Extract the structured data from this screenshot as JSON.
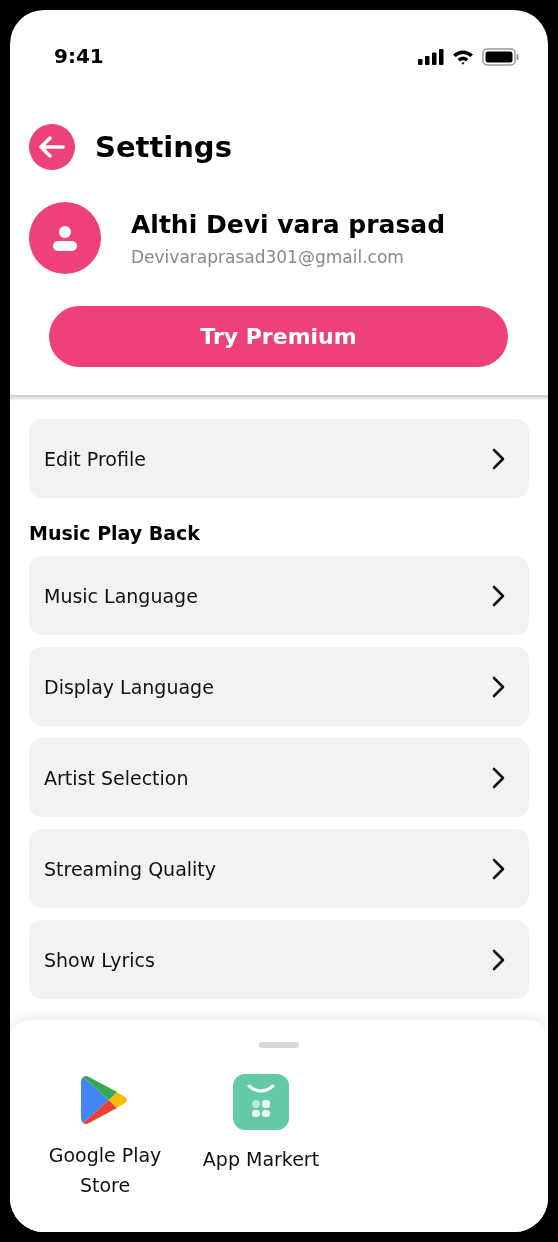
{
  "status_bar": {
    "time": "9:41"
  },
  "header": {
    "title": "Settings"
  },
  "profile": {
    "name": "Althi Devi vara prasad",
    "email": "Devivaraprasad301@gmail.com"
  },
  "premium_button": {
    "label": "Try Premium"
  },
  "menu": [
    {
      "kind": "item",
      "label": "Edit Profile"
    },
    {
      "kind": "heading",
      "label": "Music Play Back"
    },
    {
      "kind": "item",
      "label": "Music Language"
    },
    {
      "kind": "item",
      "label": "Display Language"
    },
    {
      "kind": "item",
      "label": "Artist Selection"
    },
    {
      "kind": "item",
      "label": "Streaming Quality"
    },
    {
      "kind": "item",
      "label": "Show Lyrics"
    }
  ],
  "share_sheet": {
    "apps": [
      {
        "kind": "play",
        "label": "Google Play Store"
      },
      {
        "kind": "market",
        "label": "App Markert"
      }
    ]
  }
}
